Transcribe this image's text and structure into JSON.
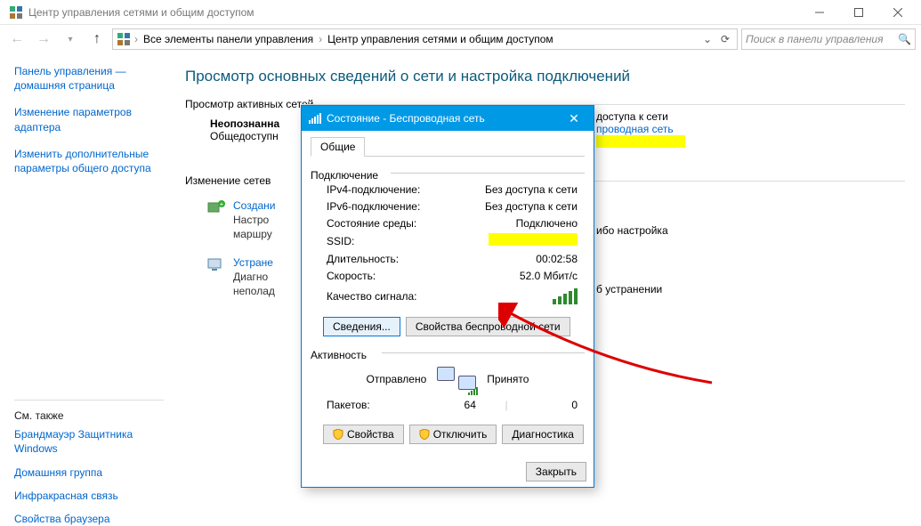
{
  "window": {
    "title": "Центр управления сетями и общим доступом"
  },
  "breadcrumb": {
    "item1": "Все элементы панели управления",
    "item2": "Центр управления сетями и общим доступом"
  },
  "search": {
    "placeholder": "Поиск в панели управления"
  },
  "sidebar": {
    "home1": "Панель управления —",
    "home2": "домашняя страница",
    "link1a": "Изменение параметров",
    "link1b": "адаптера",
    "link2a": "Изменить дополнительные",
    "link2b": "параметры общего доступа",
    "seeAlso": "См. также",
    "fw1": "Брандмауэр Защитника",
    "fw2": "Windows",
    "hg": "Домашняя группа",
    "ir": "Инфракрасная связь",
    "bp": "Свойства браузера"
  },
  "main": {
    "heading": "Просмотр основных сведений о сети и настройка подключений",
    "activeLabel": "Просмотр активных сетей",
    "netName": "Неопознанна",
    "netType": "Общедоступн",
    "accessRow": "доступа к сети",
    "connRow": "проводная сеть",
    "changeLabel": "Изменение сетев",
    "action1Title": "Создани",
    "action1Sub1": "Настро",
    "action1Sub2": "маршру",
    "action1Tail": "ибо настройка",
    "action2Title": "Устране",
    "action2Sub1": "Диагно",
    "action2Sub2": "неполад",
    "action2Tail": "б устранении"
  },
  "dialog": {
    "title": "Состояние - Беспроводная сеть",
    "tabGeneral": "Общие",
    "fsConn": "Подключение",
    "ipv4k": "IPv4-подключение:",
    "ipv4v": "Без доступа к сети",
    "ipv6k": "IPv6-подключение:",
    "ipv6v": "Без доступа к сети",
    "mediak": "Состояние среды:",
    "mediav": "Подключено",
    "ssidk": "SSID:",
    "durk": "Длительность:",
    "durv": "00:02:58",
    "spdk": "Скорость:",
    "spdv": "52.0 Мбит/с",
    "qualk": "Качество сигнала:",
    "btnDetails": "Сведения...",
    "btnWprops": "Свойства беспроводной сети",
    "fsAct": "Активность",
    "sent": "Отправлено",
    "recv": "Принято",
    "pktk": "Пакетов:",
    "pktSent": "64",
    "pktRecv": "0",
    "btnProps": "Свойства",
    "btnDisc": "Отключить",
    "btnDiag": "Диагностика",
    "btnClose": "Закрыть"
  }
}
